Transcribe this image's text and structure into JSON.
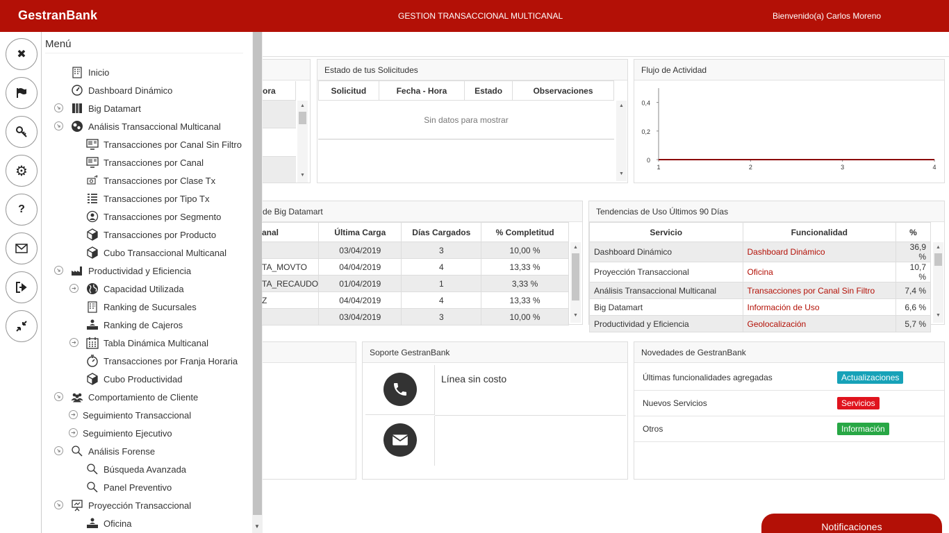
{
  "header": {
    "brand": "GestranBank",
    "title": "GESTION TRANSACCIONAL MULTICANAL",
    "welcome": "Bienvenido(a) Carlos Moreno"
  },
  "menu": {
    "title": "Menú",
    "items": [
      {
        "label": "Inicio",
        "icon": "building-icon"
      },
      {
        "label": "Dashboard Dinámico",
        "icon": "gauge-icon"
      },
      {
        "label": "Big Datamart",
        "icon": "database-icon"
      },
      {
        "label": "Análisis Transaccional Multicanal",
        "icon": "gears-icon"
      },
      {
        "label": "Transacciones por Canal Sin Filtro",
        "icon": "monitor-icon"
      },
      {
        "label": "Transacciones por Canal",
        "icon": "monitor-icon"
      },
      {
        "label": "Transacciones por Clase Tx",
        "icon": "money-icon"
      },
      {
        "label": "Transacciones por Tipo Tx",
        "icon": "list-icon"
      },
      {
        "label": "Transacciones por Segmento",
        "icon": "user-circle-icon"
      },
      {
        "label": "Transacciones por Producto",
        "icon": "cube-icon"
      },
      {
        "label": "Cubo Transaccional Multicanal",
        "icon": "cube-icon"
      },
      {
        "label": "Productividad y Eficiencia",
        "icon": "factory-icon"
      },
      {
        "label": "Capacidad Utilizada",
        "icon": "globe-icon"
      },
      {
        "label": "Ranking de Sucursales",
        "icon": "building-icon"
      },
      {
        "label": "Ranking de Cajeros",
        "icon": "cashier-icon"
      },
      {
        "label": "Tabla Dinámica Multicanal",
        "icon": "calendar-icon"
      },
      {
        "label": "Transacciones por Franja Horaria",
        "icon": "stopwatch-icon"
      },
      {
        "label": "Cubo Productividad",
        "icon": "cube-icon"
      },
      {
        "label": "Comportamiento de Cliente",
        "icon": "users-icon"
      },
      {
        "label": "Seguimiento Transaccional",
        "icon": ""
      },
      {
        "label": "Seguimiento Ejecutivo",
        "icon": ""
      },
      {
        "label": "Análisis Forense",
        "icon": "magnifier-icon"
      },
      {
        "label": "Búsqueda Avanzada",
        "icon": "magnifier-icon"
      },
      {
        "label": "Panel Preventivo",
        "icon": "magnifier-icon"
      },
      {
        "label": "Proyección Transaccional",
        "icon": "presentation-icon"
      },
      {
        "label": "Oficina",
        "icon": "cashier-icon"
      }
    ]
  },
  "rail": [
    {
      "name": "close-icon",
      "glyph": "✖"
    },
    {
      "name": "flag-icon",
      "glyph": ""
    },
    {
      "name": "key-icon",
      "glyph": ""
    },
    {
      "name": "gear-icon",
      "glyph": "⚙"
    },
    {
      "name": "help-icon",
      "glyph": "?"
    },
    {
      "name": "mail-icon",
      "glyph": ""
    },
    {
      "name": "logout-icon",
      "glyph": ""
    },
    {
      "name": "compress-icon",
      "glyph": ""
    }
  ],
  "solicitudes_left": {
    "col": "ora"
  },
  "solicitudes": {
    "title": "Estado de tus Solicitudes",
    "columns": [
      "Solicitud",
      "Fecha - Hora",
      "Estado",
      "Observaciones"
    ],
    "empty": "Sin datos para mostrar"
  },
  "flujo": {
    "title": "Flujo de Actividad",
    "chart_data": {
      "type": "line",
      "x": [
        1,
        2,
        3,
        4
      ],
      "series": [
        {
          "values": [
            0,
            0,
            0,
            0
          ]
        }
      ],
      "yticks": [
        "0,4",
        "0,2",
        "0"
      ],
      "xticks": [
        "1",
        "2",
        "3",
        "4"
      ],
      "ylim": [
        0,
        0.5
      ],
      "xlim": [
        1,
        4
      ],
      "color": "#8b0000"
    }
  },
  "bigdatamart": {
    "title": "de Big Datamart",
    "columns": [
      "anal",
      "Última Carga",
      "Días Cargados",
      "% Completitud"
    ],
    "rows": [
      [
        "",
        "03/04/2019",
        "3",
        "10,00 %"
      ],
      [
        "TA_MOVTO",
        "04/04/2019",
        "4",
        "13,33 %"
      ],
      [
        "TA_RECAUDO",
        "01/04/2019",
        "1",
        "3,33 %"
      ],
      [
        "Z",
        "04/04/2019",
        "4",
        "13,33 %"
      ],
      [
        "",
        "03/04/2019",
        "3",
        "10,00 %"
      ]
    ]
  },
  "tendencias": {
    "title": "Tendencias de Uso Últimos 90 Días",
    "columns": [
      "Servicio",
      "Funcionalidad",
      "%"
    ],
    "rows": [
      [
        "Dashboard Dinámico",
        "Dashboard Dinámico",
        "36,9 %"
      ],
      [
        "Proyección Transaccional",
        "Oficina",
        "10,7 %"
      ],
      [
        "Análisis Transaccional Multicanal",
        "Transacciones por Canal Sin Filtro",
        "7,4 %"
      ],
      [
        "Big Datamart",
        "Información de Uso",
        "6,6 %"
      ],
      [
        "Productividad y Eficiencia",
        "Geolocalización",
        "5,7 %"
      ]
    ]
  },
  "soporte": {
    "title": "Soporte GestranBank",
    "phone_text": "Línea sin costo",
    "mail_text": ""
  },
  "novedades": {
    "title": "Novedades de GestranBank",
    "items": [
      {
        "label": "Últimas funcionalidades agregadas",
        "badge": "Actualizaciones",
        "color": "#17a2b8"
      },
      {
        "label": "Nuevos Servicios",
        "badge": "Servicios",
        "color": "#e0141e"
      },
      {
        "label": "Otros",
        "badge": "Información",
        "color": "#28a745"
      }
    ]
  },
  "notificaciones": "Notificaciones"
}
